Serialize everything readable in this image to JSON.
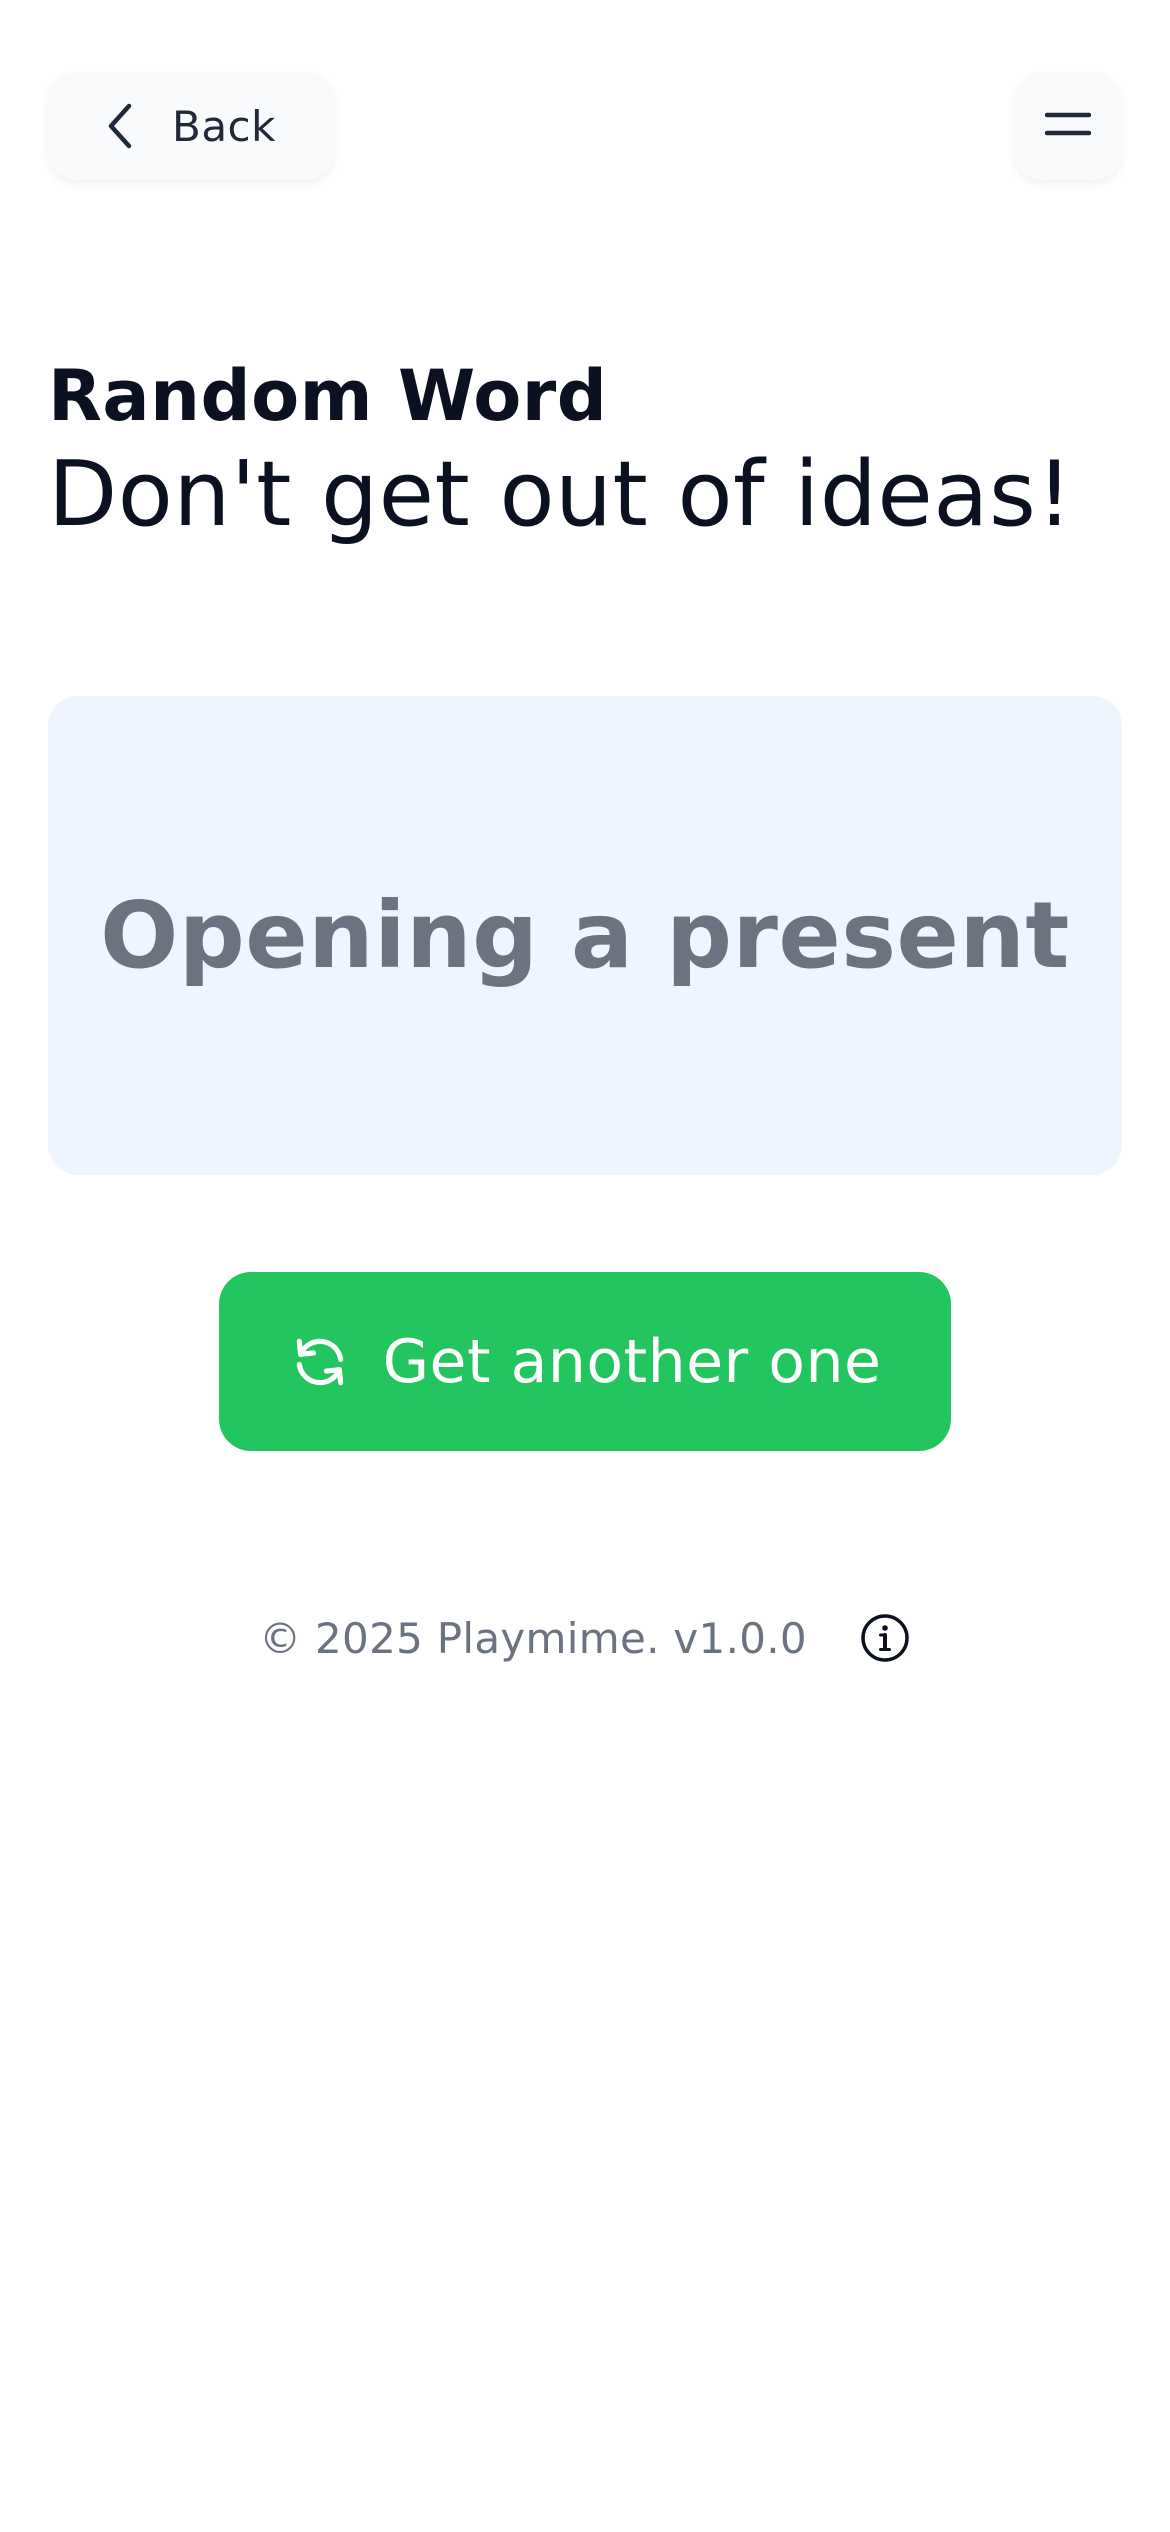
{
  "header": {
    "back_label": "Back",
    "back_icon": "chevron-left-icon",
    "menu_icon": "menu-icon"
  },
  "page": {
    "title": "Random Word",
    "subtitle": "Don't get out of ideas!"
  },
  "word_card": {
    "word": "Opening a present",
    "background_color": "#eef5ff",
    "text_color": "#6b7280"
  },
  "action": {
    "label": "Get another one",
    "icon": "refresh-icon",
    "color": "#22c55e"
  },
  "footer": {
    "text": "© 2025 Playmime. v1.0.0",
    "info_icon": "info-icon"
  }
}
